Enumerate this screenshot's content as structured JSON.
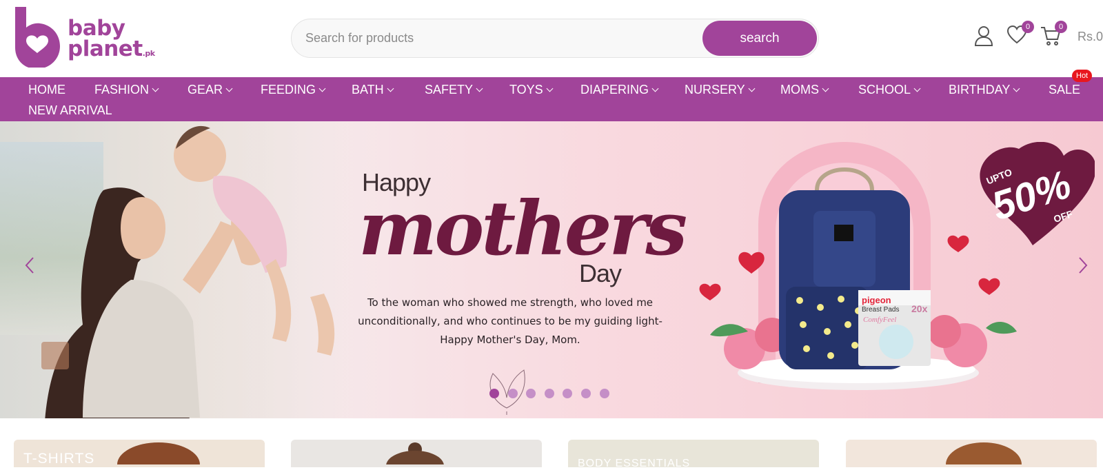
{
  "brand": {
    "name_line1": "baby",
    "name_line2": "planet",
    "suffix": ".pk",
    "color": "#a1449a"
  },
  "search": {
    "placeholder": "Search for products",
    "button_label": "search"
  },
  "header_icons": {
    "account": "user-icon",
    "wishlist": {
      "icon": "heart-icon",
      "count": "0"
    },
    "cart": {
      "icon": "cart-icon",
      "count": "0",
      "total": "Rs.0"
    }
  },
  "nav": {
    "items": [
      {
        "label": "HOME",
        "dropdown": false
      },
      {
        "label": "FASHION",
        "dropdown": true
      },
      {
        "label": "GEAR",
        "dropdown": true
      },
      {
        "label": "FEEDING",
        "dropdown": true
      },
      {
        "label": "BATH",
        "dropdown": true
      },
      {
        "label": "SAFETY",
        "dropdown": true
      },
      {
        "label": "TOYS",
        "dropdown": true
      },
      {
        "label": "DIAPERING",
        "dropdown": true
      },
      {
        "label": "NURSERY",
        "dropdown": true
      },
      {
        "label": "MOMS",
        "dropdown": true
      },
      {
        "label": "SCHOOL",
        "dropdown": true
      },
      {
        "label": "BIRTHDAY",
        "dropdown": true
      },
      {
        "label": "SALE",
        "dropdown": false,
        "badge": "Hot"
      },
      {
        "label": "NEW ARRIVAL",
        "dropdown": false
      }
    ]
  },
  "hero": {
    "happy": "Happy",
    "mothers": "mothers",
    "day": "Day",
    "tagline_1": "To the woman who showed me strength, who loved me",
    "tagline_2": "unconditionally, and who continues to be my guiding light-",
    "tagline_3": "Happy Mother's Day, Mom.",
    "offer_upto": "UPTO",
    "offer_value": "50%",
    "offer_off": "OFF",
    "product_brand": "pigeon",
    "product_name": "Breast Pads",
    "product_sub": "ComfyFeel",
    "product_tag": "20x",
    "slide_count": 7,
    "active_slide": 0
  },
  "categories": [
    {
      "label": "T-SHIRTS",
      "bg": "#efe4d8"
    },
    {
      "label": "",
      "bg": "#e9e6e3"
    },
    {
      "label": "BODY ESSENTIALS",
      "bg": "#e8e5d9"
    },
    {
      "label": "",
      "bg": "#f2e6dc"
    }
  ],
  "colors": {
    "accent": "#a1449a",
    "hot_badge": "#e8171f",
    "hero_dark": "#6e1a40"
  }
}
